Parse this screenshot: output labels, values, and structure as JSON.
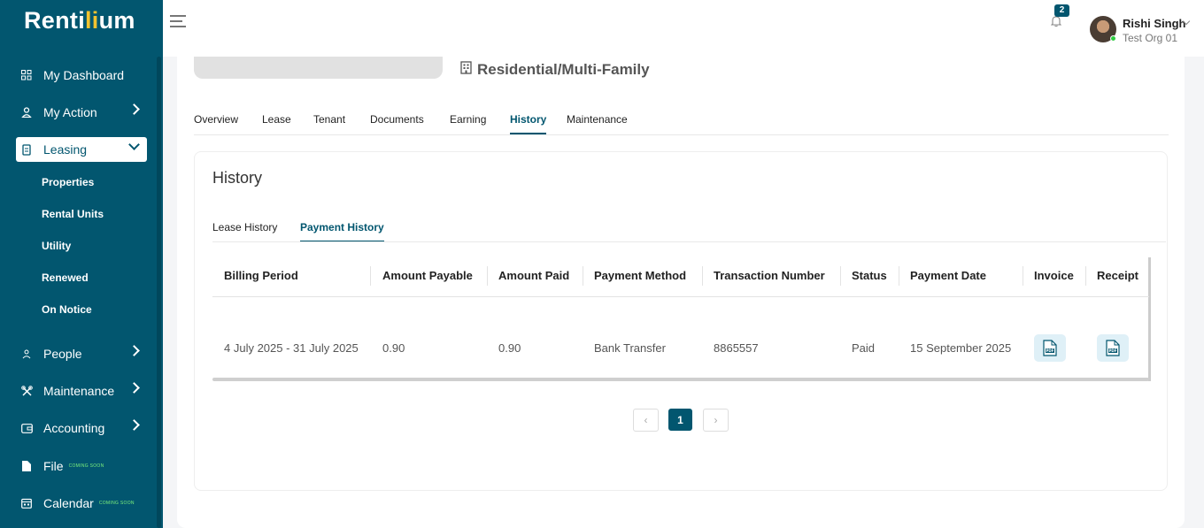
{
  "app": {
    "logo_pre": "Renti",
    "logo_hl": "li",
    "logo_post": "um"
  },
  "sidebar": {
    "items": [
      {
        "label": "My Dashboard"
      },
      {
        "label": "My Action"
      },
      {
        "label": "Leasing"
      },
      {
        "label": "People"
      },
      {
        "label": "Maintenance"
      },
      {
        "label": "Accounting"
      },
      {
        "label": "File",
        "badge": "COMING SOON"
      },
      {
        "label": "Calendar",
        "badge": "COMING SOON"
      }
    ],
    "leasing_sub": [
      {
        "label": "Properties"
      },
      {
        "label": "Rental Units"
      },
      {
        "label": "Utility"
      },
      {
        "label": "Renewed"
      },
      {
        "label": "On Notice"
      }
    ]
  },
  "header": {
    "notifications_count": "2",
    "user_name": "Rishi Singh",
    "user_org": "Test Org 01"
  },
  "property": {
    "type": "Residential/Multi-Family"
  },
  "tabs": [
    {
      "label": "Overview"
    },
    {
      "label": "Lease"
    },
    {
      "label": "Tenant"
    },
    {
      "label": "Documents"
    },
    {
      "label": "Earning"
    },
    {
      "label": "History",
      "active": true
    },
    {
      "label": "Maintenance"
    }
  ],
  "history": {
    "title": "History",
    "subtabs": [
      {
        "label": "Lease History"
      },
      {
        "label": "Payment History",
        "active": true
      }
    ],
    "columns": [
      "Billing Period",
      "Amount Payable",
      "Amount Paid",
      "Payment Method",
      "Transaction Number",
      "Status",
      "Payment Date",
      "Invoice",
      "Receipt"
    ],
    "rows": [
      {
        "billing_period": "4 July 2025 - 31 July 2025",
        "amount_payable": "0.90",
        "amount_paid": "0.90",
        "payment_method": "Bank Transfer",
        "transaction_number": "8865557",
        "status": "Paid",
        "payment_date": "15 September 2025",
        "invoice_icon": "pdf-icon",
        "receipt_icon": "pdf-icon"
      }
    ],
    "pagination": {
      "current": "1",
      "prev": "‹",
      "next": "›"
    }
  },
  "colors": {
    "primary": "#02566f",
    "accent": "#f2c230",
    "online": "#2ecc40"
  }
}
